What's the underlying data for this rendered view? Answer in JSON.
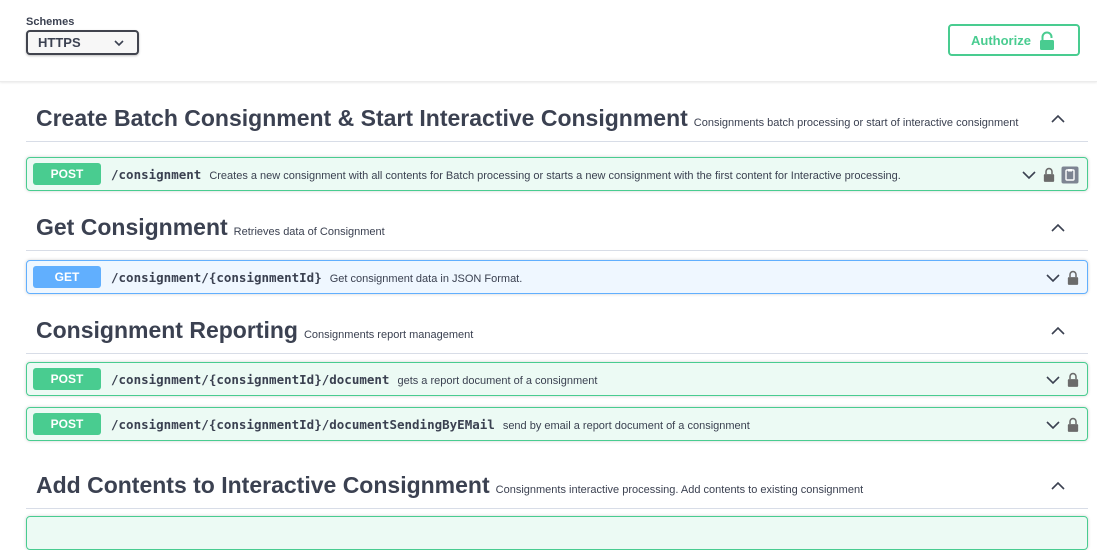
{
  "schemes": {
    "label": "Schemes",
    "selected": "HTTPS"
  },
  "authorize": {
    "label": "Authorize"
  },
  "tags": [
    {
      "title": "Create Batch Consignment & Start Interactive Consignment",
      "description": "Consignments batch processing or start of interactive consignment",
      "operations": [
        {
          "method": "POST",
          "path": "/consignment",
          "summary": "Creates a new consignment with all contents for Batch processing or starts a new consignment with the first content for Interactive processing."
        }
      ]
    },
    {
      "title": "Get Consignment",
      "description": "Retrieves data of Consignment",
      "operations": [
        {
          "method": "GET",
          "path": "/consignment/{consignmentId}",
          "summary": "Get consignment data in JSON Format."
        }
      ]
    },
    {
      "title": "Consignment Reporting",
      "description": "Consignments report management",
      "operations": [
        {
          "method": "POST",
          "path": "/consignment/{consignmentId}/document",
          "summary": "gets a report document of a consignment"
        },
        {
          "method": "POST",
          "path": "/consignment/{consignmentId}/documentSendingByEMail",
          "summary": "send by email a report document of a consignment"
        }
      ]
    },
    {
      "title": "Add Contents to Interactive Consignment",
      "description": "Consignments interactive processing. Add contents to existing consignment",
      "operations": []
    }
  ],
  "colors": {
    "post": "#49cc90",
    "get": "#61affe",
    "text": "#3b4151"
  },
  "icons": {
    "select_chevron": "chevron-down-icon",
    "authorize_lock": "lock-icon",
    "tag_toggle": "chevron-up-icon",
    "op_expand": "chevron-down-icon",
    "op_lock": "lock-icon",
    "op_copy": "copy-to-clipboard-icon"
  }
}
